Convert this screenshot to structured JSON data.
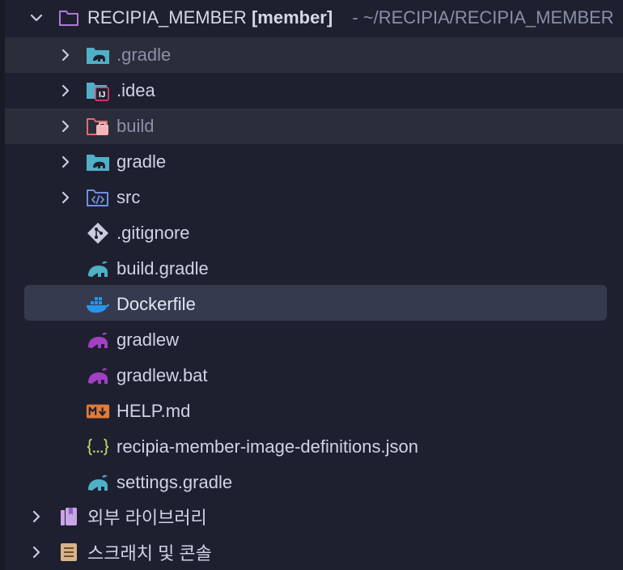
{
  "root": {
    "name": "RECIPIA_MEMBER",
    "module": "[member]",
    "path": "- ~/RECIPIA/RECIPIA_MEMBER"
  },
  "items": [
    {
      "label": ".gradle",
      "icon": "gradle-folder-icon",
      "expandable": true,
      "excluded": true
    },
    {
      "label": ".idea",
      "icon": "idea-folder-icon",
      "expandable": true,
      "excluded": false
    },
    {
      "label": "build",
      "icon": "excluded-folder-icon",
      "expandable": true,
      "excluded": true
    },
    {
      "label": "gradle",
      "icon": "gradle-folder-icon",
      "expandable": true,
      "excluded": false
    },
    {
      "label": "src",
      "icon": "source-folder-icon",
      "expandable": true,
      "excluded": false
    },
    {
      "label": ".gitignore",
      "icon": "git-icon",
      "expandable": false
    },
    {
      "label": "build.gradle",
      "icon": "gradle-file-icon",
      "expandable": false
    },
    {
      "label": "Dockerfile",
      "icon": "docker-icon",
      "expandable": false,
      "selected": true
    },
    {
      "label": "gradlew",
      "icon": "gradle-wrapper-icon",
      "expandable": false
    },
    {
      "label": "gradlew.bat",
      "icon": "gradle-wrapper-icon",
      "expandable": false
    },
    {
      "label": "HELP.md",
      "icon": "markdown-icon",
      "expandable": false
    },
    {
      "label": "recipia-member-image-definitions.json",
      "icon": "json-icon",
      "expandable": false
    },
    {
      "label": "settings.gradle",
      "icon": "gradle-file-icon",
      "expandable": false
    }
  ],
  "bottom": [
    {
      "label": "외부 라이브러리",
      "icon": "library-icon"
    },
    {
      "label": "스크래치 및 콘솔",
      "icon": "scratches-icon"
    }
  ],
  "colors": {
    "background": "#1e2030",
    "selected": "#363a4f",
    "excluded_row": "#2b2d3b",
    "gradle_blue": "#4fb0c6",
    "gradle_purple": "#a33fc4",
    "docker_blue": "#2496ed",
    "markdown_orange": "#e07b39",
    "json_yellow": "#c3d25a"
  }
}
